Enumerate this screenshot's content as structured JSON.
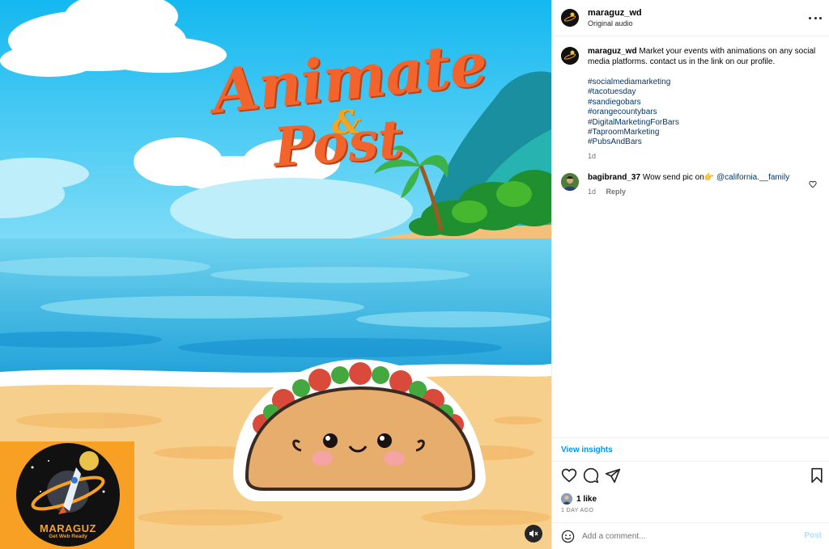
{
  "media": {
    "title_line1": "Animate",
    "title_amp": "&",
    "title_line2": "Post",
    "logo_name": "MARAGUZ",
    "logo_tagline": "Get Web Ready",
    "mute_icon": "speaker-muted-icon"
  },
  "header": {
    "username": "maraguz_wd",
    "subtitle": "Original audio",
    "more_icon": "more-options-icon"
  },
  "caption": {
    "username": "maraguz_wd",
    "text": "Market your events with animations on any social media platforms. contact us in the link on our profile.",
    "hashtags": [
      "#socialmediamarketing",
      "#tacotuesday",
      "#sandiegobars",
      "#orangecountybars",
      "#DigitalMarketingForBars",
      "#TaproomMarketing",
      "#PubsAndBars"
    ],
    "time": "1d"
  },
  "comments": [
    {
      "username": "bagibrand_37",
      "text": "Wow send pic on👉",
      "mention": "@california.__family",
      "time": "1d",
      "reply_label": "Reply"
    }
  ],
  "insights_label": "View insights",
  "likes": {
    "count_label": "1 like",
    "date": "1 DAY AGO"
  },
  "add_comment": {
    "placeholder": "Add a comment...",
    "post_label": "Post"
  },
  "colors": {
    "accent_blue": "#0095f6",
    "link_blue": "#00376b",
    "title_orange": "#f2642b",
    "logo_orange": "#f7a024"
  }
}
